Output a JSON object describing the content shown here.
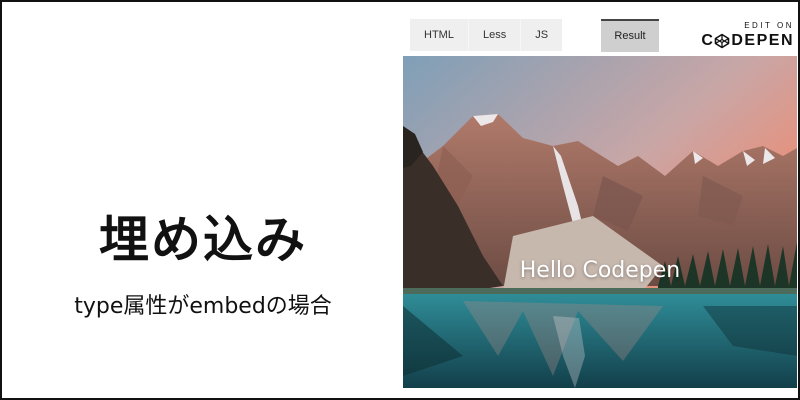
{
  "slide": {
    "title": "埋め込み",
    "subtitle": "type属性がembedの場合"
  },
  "codepen_embed": {
    "tabs": [
      {
        "label": "HTML"
      },
      {
        "label": "Less"
      },
      {
        "label": "JS"
      }
    ],
    "active_tab": "Result",
    "edit_on_label": "EDIT ON",
    "brand_prefix": "C",
    "brand_suffix": "DEPEN",
    "result_heading": "Hello Codepen"
  },
  "colors": {
    "sky_top": "#8aa6bd",
    "sky_glow": "#f08a70",
    "lake": "#1f7280",
    "forest": "#1d3526"
  }
}
